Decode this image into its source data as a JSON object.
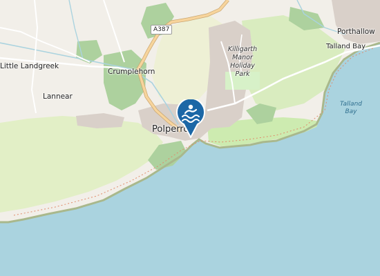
{
  "map": {
    "places": {
      "porthallow": "Porthallow",
      "talland_bay": "Talland Bay",
      "little_landgreek": "Little Landgreek",
      "crumplehorn": "Crumplehorn",
      "lannear": "Lannear",
      "polperro": "Polperro"
    },
    "holiday_park": [
      "Killigarth",
      "Manor",
      "Holiday",
      "Park"
    ],
    "water_label": [
      "Talland",
      "Bay"
    ],
    "road_ref": "A387",
    "marker": {
      "icon": "swimming-icon",
      "color": "#1c67a6"
    },
    "colors": {
      "sea": "#aad3df",
      "land": "#f2efe9",
      "farmland": "#eef0d5",
      "grass": "#cdebb0",
      "wood": "#add19e",
      "urban": "#d9d0c9",
      "road": "#ffffff",
      "primary_road": "#f7d49c"
    }
  }
}
